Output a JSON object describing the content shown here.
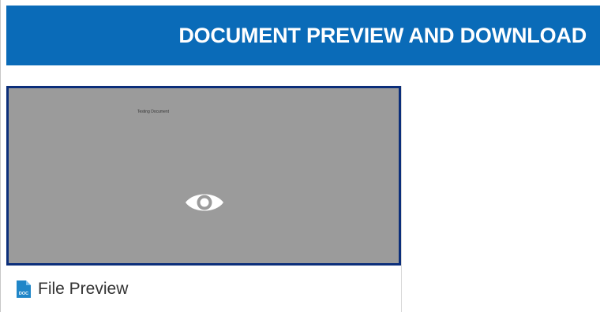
{
  "header": {
    "title": "DOCUMENT PREVIEW AND DOWNLOAD"
  },
  "card": {
    "preview": {
      "document_title": "Testing Document",
      "icon": "eye-icon"
    },
    "file": {
      "icon": "doc-file-icon",
      "icon_text": "DOC",
      "label": "File Preview"
    }
  },
  "colors": {
    "header_bg": "#0a6bb8",
    "preview_bg": "#9b9b9b",
    "preview_border": "#0b2e7a",
    "doc_icon": "#1f86c8"
  }
}
